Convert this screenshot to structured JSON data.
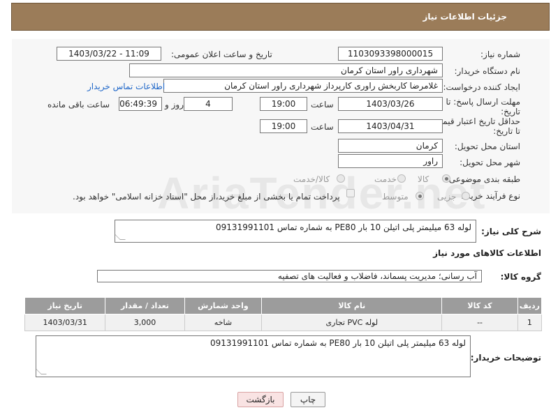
{
  "header": {
    "title": "جزئیات اطلاعات نیاز"
  },
  "form": {
    "need_number_label": "شماره نیاز:",
    "need_number": "1103093398000015",
    "announce_label": "تاریخ و ساعت اعلان عمومی:",
    "announce_value": "1403/03/22 - 11:09",
    "buyer_label": "نام دستگاه خریدار:",
    "buyer_value": "شهرداری راور استان کرمان",
    "creator_label": "ایجاد کننده درخواست:",
    "creator_value": "غلامرضا کاربخش راوری کارپرداز  شهرداری راور استان کرمان",
    "contact_link": "اطلاعات تماس خریدار",
    "reply_deadline_label": "مهلت ارسال پاسخ: تا تاریخ:",
    "reply_date": "1403/03/26",
    "time_label": "ساعت",
    "reply_time": "19:00",
    "days_value": "4",
    "days_label": "روز و",
    "remaining_time": "06:49:39",
    "remaining_label": "ساعت باقی مانده",
    "price_validity_label": "حداقل تاریخ اعتبار قیمت: تا تاریخ:",
    "price_date": "1403/04/31",
    "price_time": "19:00",
    "province_label": "استان محل تحویل:",
    "province_value": "کرمان",
    "city_label": "شهر محل تحویل:",
    "city_value": "راور",
    "category_label": "طبقه بندی موضوعی:",
    "category_options": [
      "کالا",
      "خدمت",
      "کالا/خدمت"
    ],
    "process_label": "نوع فرآیند خرید :",
    "process_options": [
      "جزیی",
      "متوسط"
    ],
    "payment_note": "پرداخت تمام یا بخشی از مبلغ خرید،از محل \"اسناد خزانه اسلامی\" خواهد بود."
  },
  "description": {
    "label": "شرح کلی نیاز:",
    "value": "لوله 63 میلیمتر پلی اتیلن 10 بار PE80   به شماره تماس 09131991101"
  },
  "goods_section": {
    "title": "اطلاعات کالاهای مورد نیاز",
    "group_label": "گروه کالا:",
    "group_value": "آب رسانی؛ مدیریت پسماند، فاضلاب و فعالیت های تصفیه"
  },
  "table": {
    "headers": [
      "ردیف",
      "کد کالا",
      "نام کالا",
      "واحد شمارش",
      "تعداد / مقدار",
      "تاریخ نیاز"
    ],
    "rows": [
      [
        "1",
        "--",
        "لوله PVC تجاری",
        "شاخه",
        "3,000",
        "1403/03/31"
      ]
    ]
  },
  "buyer_notes": {
    "label": "توضیحات خریدار:",
    "value": "لوله 63 میلیمتر پلی اتیلن 10 بار PE80   به شماره تماس 09131991101"
  },
  "buttons": {
    "print": "چاپ",
    "back": "بازگشت"
  },
  "watermark": "AriaTender.net"
}
